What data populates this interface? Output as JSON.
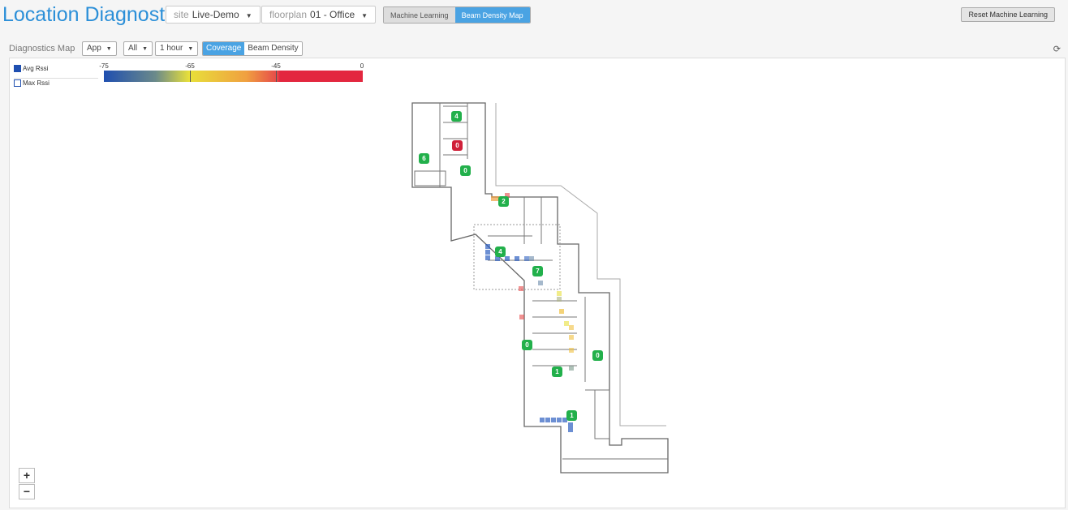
{
  "header": {
    "title": "Location Diagnostics",
    "site_key": "site",
    "site_value": "Live-Demo",
    "floorplan_key": "floorplan",
    "floorplan_value": "01 - Office",
    "mode_tabs": [
      "Machine Learning",
      "Beam Density Map"
    ],
    "active_mode": "Beam Density Map",
    "reset_label": "Reset Machine Learning"
  },
  "toolbar": {
    "label": "Diagnostics Map",
    "filter1": "App",
    "filter2": "All",
    "time": "1 hour",
    "view_tabs": [
      "Coverage",
      "Beam Density"
    ],
    "active_view": "Coverage"
  },
  "legend": {
    "avg": "Avg Rssi",
    "max": "Max Rssi",
    "scale_labels": [
      "-75",
      "-65",
      "-45",
      "0"
    ]
  },
  "markers": [
    {
      "value": "4",
      "color": "#22b04b"
    },
    {
      "value": "0",
      "color": "#d0213a"
    },
    {
      "value": "6",
      "color": "#22b04b"
    },
    {
      "value": "0",
      "color": "#22b04b"
    },
    {
      "value": "2",
      "color": "#22b04b"
    },
    {
      "value": "4",
      "color": "#22b04b"
    },
    {
      "value": "7",
      "color": "#22b04b"
    },
    {
      "value": "0",
      "color": "#22b04b"
    },
    {
      "value": "0",
      "color": "#22b04b"
    },
    {
      "value": "1",
      "color": "#22b04b"
    },
    {
      "value": "1",
      "color": "#22b04b"
    }
  ],
  "zoom": {
    "in": "+",
    "out": "−"
  }
}
